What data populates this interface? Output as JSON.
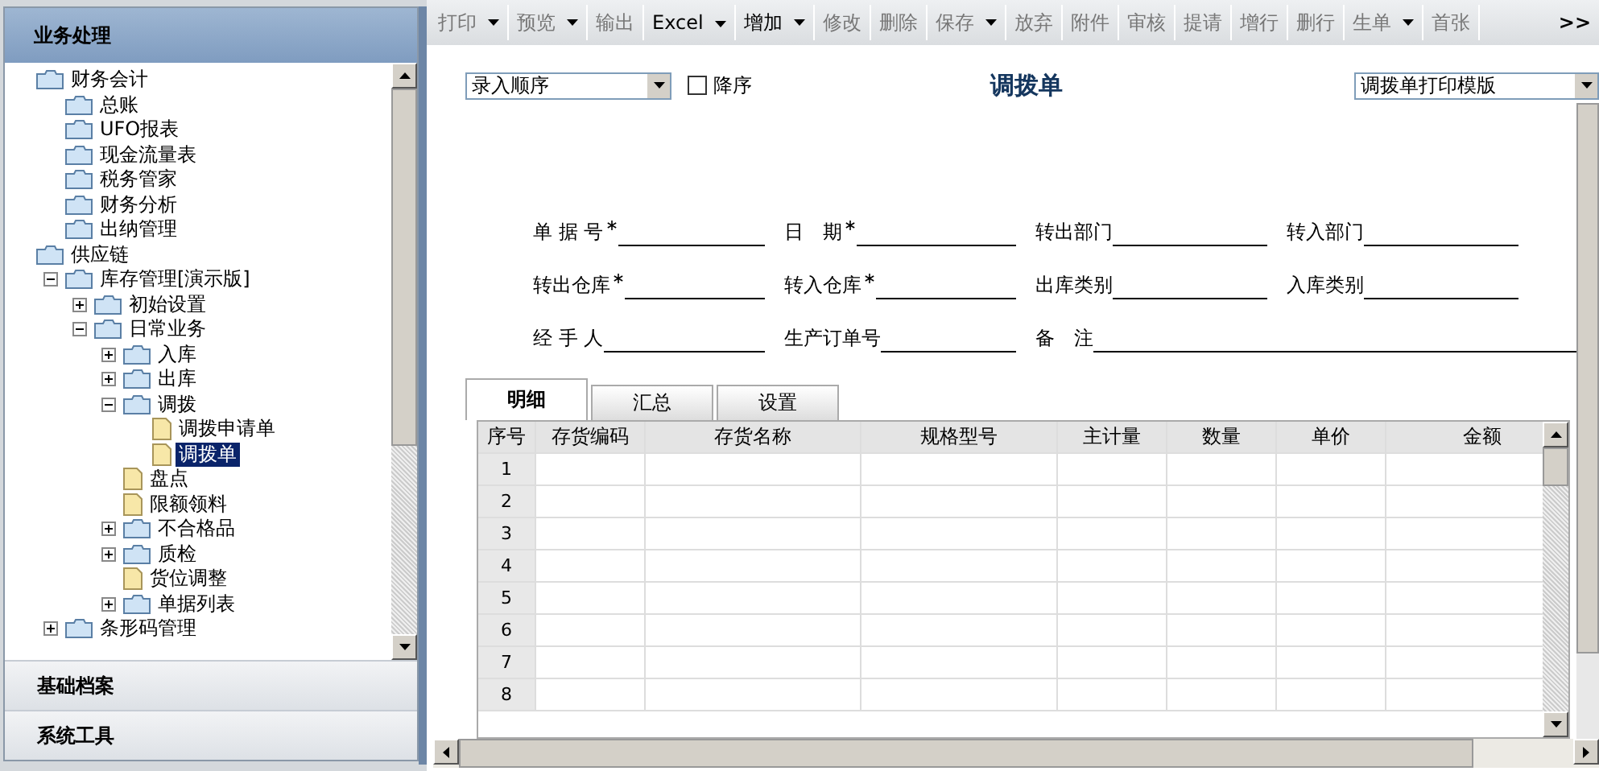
{
  "sidebar": {
    "title": "业务处理",
    "tree": [
      {
        "label": "财务会计",
        "kind": "folder",
        "selected": false,
        "children": [
          {
            "label": "总账",
            "kind": "folder",
            "selected": false
          },
          {
            "label": "UFO报表",
            "kind": "folder",
            "selected": false
          },
          {
            "label": "现金流量表",
            "kind": "folder",
            "selected": false
          },
          {
            "label": "税务管家",
            "kind": "folder",
            "selected": false
          },
          {
            "label": "财务分析",
            "kind": "folder",
            "selected": false
          },
          {
            "label": "出纳管理",
            "kind": "folder",
            "selected": false
          }
        ]
      },
      {
        "label": "供应链",
        "kind": "folder",
        "selected": false,
        "children": [
          {
            "label": "库存管理[演示版]",
            "kind": "folder",
            "selected": false,
            "expanded": true,
            "children": [
              {
                "label": "初始设置",
                "kind": "folder",
                "selected": false,
                "expanded": false
              },
              {
                "label": "日常业务",
                "kind": "folder",
                "selected": false,
                "expanded": true,
                "children": [
                  {
                    "label": "入库",
                    "kind": "folder",
                    "selected": false,
                    "expanded": false
                  },
                  {
                    "label": "出库",
                    "kind": "folder",
                    "selected": false,
                    "expanded": false
                  },
                  {
                    "label": "调拨",
                    "kind": "folder",
                    "selected": false,
                    "expanded": true,
                    "children": [
                      {
                        "label": "调拨申请单",
                        "kind": "file",
                        "selected": false
                      },
                      {
                        "label": "调拨单",
                        "kind": "file",
                        "selected": true
                      }
                    ]
                  },
                  {
                    "label": "盘点",
                    "kind": "file",
                    "selected": false
                  },
                  {
                    "label": "限额领料",
                    "kind": "file",
                    "selected": false
                  },
                  {
                    "label": "不合格品",
                    "kind": "folder",
                    "selected": false,
                    "expanded": false
                  },
                  {
                    "label": "质检",
                    "kind": "folder",
                    "selected": false,
                    "expanded": false
                  },
                  {
                    "label": "货位调整",
                    "kind": "file",
                    "selected": false
                  },
                  {
                    "label": "单据列表",
                    "kind": "folder",
                    "selected": false,
                    "expanded": false
                  }
                ]
              }
            ]
          },
          {
            "label": "条形码管理",
            "kind": "folder",
            "selected": false,
            "expanded": false
          }
        ]
      }
    ],
    "sections": [
      "基础档案",
      "系统工具"
    ]
  },
  "toolbar": [
    {
      "label": "打印",
      "dropdown": true,
      "disabled": true
    },
    {
      "label": "预览",
      "dropdown": true,
      "disabled": true
    },
    {
      "label": "输出",
      "dropdown": false,
      "disabled": true
    },
    {
      "label": "Excel",
      "dropdown": true,
      "disabled": false
    },
    {
      "label": "增加",
      "dropdown": true,
      "disabled": false
    },
    {
      "label": "修改",
      "dropdown": false,
      "disabled": true
    },
    {
      "label": "删除",
      "dropdown": false,
      "disabled": true
    },
    {
      "label": "保存",
      "dropdown": true,
      "disabled": true
    },
    {
      "label": "放弃",
      "dropdown": false,
      "disabled": true
    },
    {
      "label": "附件",
      "dropdown": false,
      "disabled": true
    },
    {
      "label": "审核",
      "dropdown": false,
      "disabled": true
    },
    {
      "label": "提请",
      "dropdown": false,
      "disabled": true
    },
    {
      "label": "增行",
      "dropdown": false,
      "disabled": true
    },
    {
      "label": "删行",
      "dropdown": false,
      "disabled": true
    },
    {
      "label": "生单",
      "dropdown": true,
      "disabled": true
    },
    {
      "label": "首张",
      "dropdown": false,
      "disabled": true
    }
  ],
  "toolbar_more": ">>",
  "sort_select": {
    "value": "录入顺序"
  },
  "descending": {
    "label": "降序",
    "checked": false
  },
  "form_title": "调拨单",
  "template_select": {
    "value": "调拨单打印模版"
  },
  "fields": [
    {
      "label": "单 据 号",
      "required": true,
      "wide": false
    },
    {
      "label": "日　期",
      "required": true,
      "wide": false
    },
    {
      "label": "转出部门",
      "required": false,
      "wide": false
    },
    {
      "label": "转入部门",
      "required": false,
      "wide": false
    },
    {
      "label": "转出仓库",
      "required": true,
      "wide": false
    },
    {
      "label": "转入仓库",
      "required": true,
      "wide": false
    },
    {
      "label": "出库类别",
      "required": false,
      "wide": false
    },
    {
      "label": "入库类别",
      "required": false,
      "wide": false
    },
    {
      "label": "经 手 人",
      "required": false,
      "wide": false
    },
    {
      "label": "生产订单号",
      "required": false,
      "wide": false
    },
    {
      "label": "备　注",
      "required": false,
      "wide": true
    }
  ],
  "tabs": [
    {
      "label": "明细",
      "selected": true
    },
    {
      "label": "汇总",
      "selected": false
    },
    {
      "label": "设置",
      "selected": false
    }
  ],
  "table": {
    "columns": [
      "序号",
      "存货编码",
      "存货名称",
      "规格型号",
      "主计量",
      "数量",
      "单价",
      "金额"
    ],
    "rows": [
      "1",
      "2",
      "3",
      "4",
      "5",
      "6",
      "7",
      "8"
    ]
  }
}
